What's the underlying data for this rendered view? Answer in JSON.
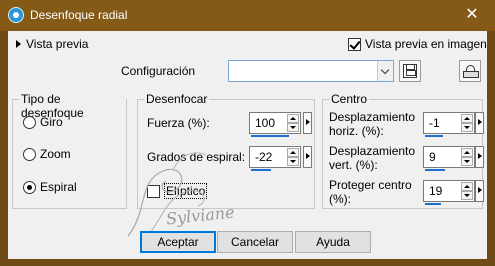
{
  "window": {
    "title": "Desenfoque radial",
    "close_glyph": "✕"
  },
  "preview": {
    "toggle_label": "Vista previa",
    "in_image_label": "Vista previa en imagen",
    "in_image_checked": true
  },
  "config": {
    "label": "Configuración",
    "value": ""
  },
  "blur_type": {
    "title": "Tipo de desenfoque",
    "options": [
      "Giro",
      "Zoom",
      "Espiral"
    ],
    "selected": "Espiral"
  },
  "blur": {
    "title": "Desenfocar",
    "strength_label": "Fuerza (%):",
    "strength_value": "100",
    "spiral_label": "Grados de espiral:",
    "spiral_value": "-22",
    "elliptic_label": "Elíptico",
    "elliptic_checked": false
  },
  "center": {
    "title": "Centro",
    "hoffset_label_1": "Desplazamiento",
    "hoffset_label_2": "horiz. (%):",
    "hoffset_value": "-1",
    "voffset_label_1": "Desplazamiento",
    "voffset_label_2": "vert. (%):",
    "voffset_value": "9",
    "protect_label_1": "Proteger centro",
    "protect_label_2": "(%):",
    "protect_value": "19"
  },
  "watermark": "Sylviane",
  "buttons": {
    "ok": "Aceptar",
    "cancel": "Cancelar",
    "help": "Ayuda"
  },
  "colors": {
    "title_bar": "#855916",
    "accent": "#0078d7",
    "dialog_bg": "#f0f0f0"
  }
}
